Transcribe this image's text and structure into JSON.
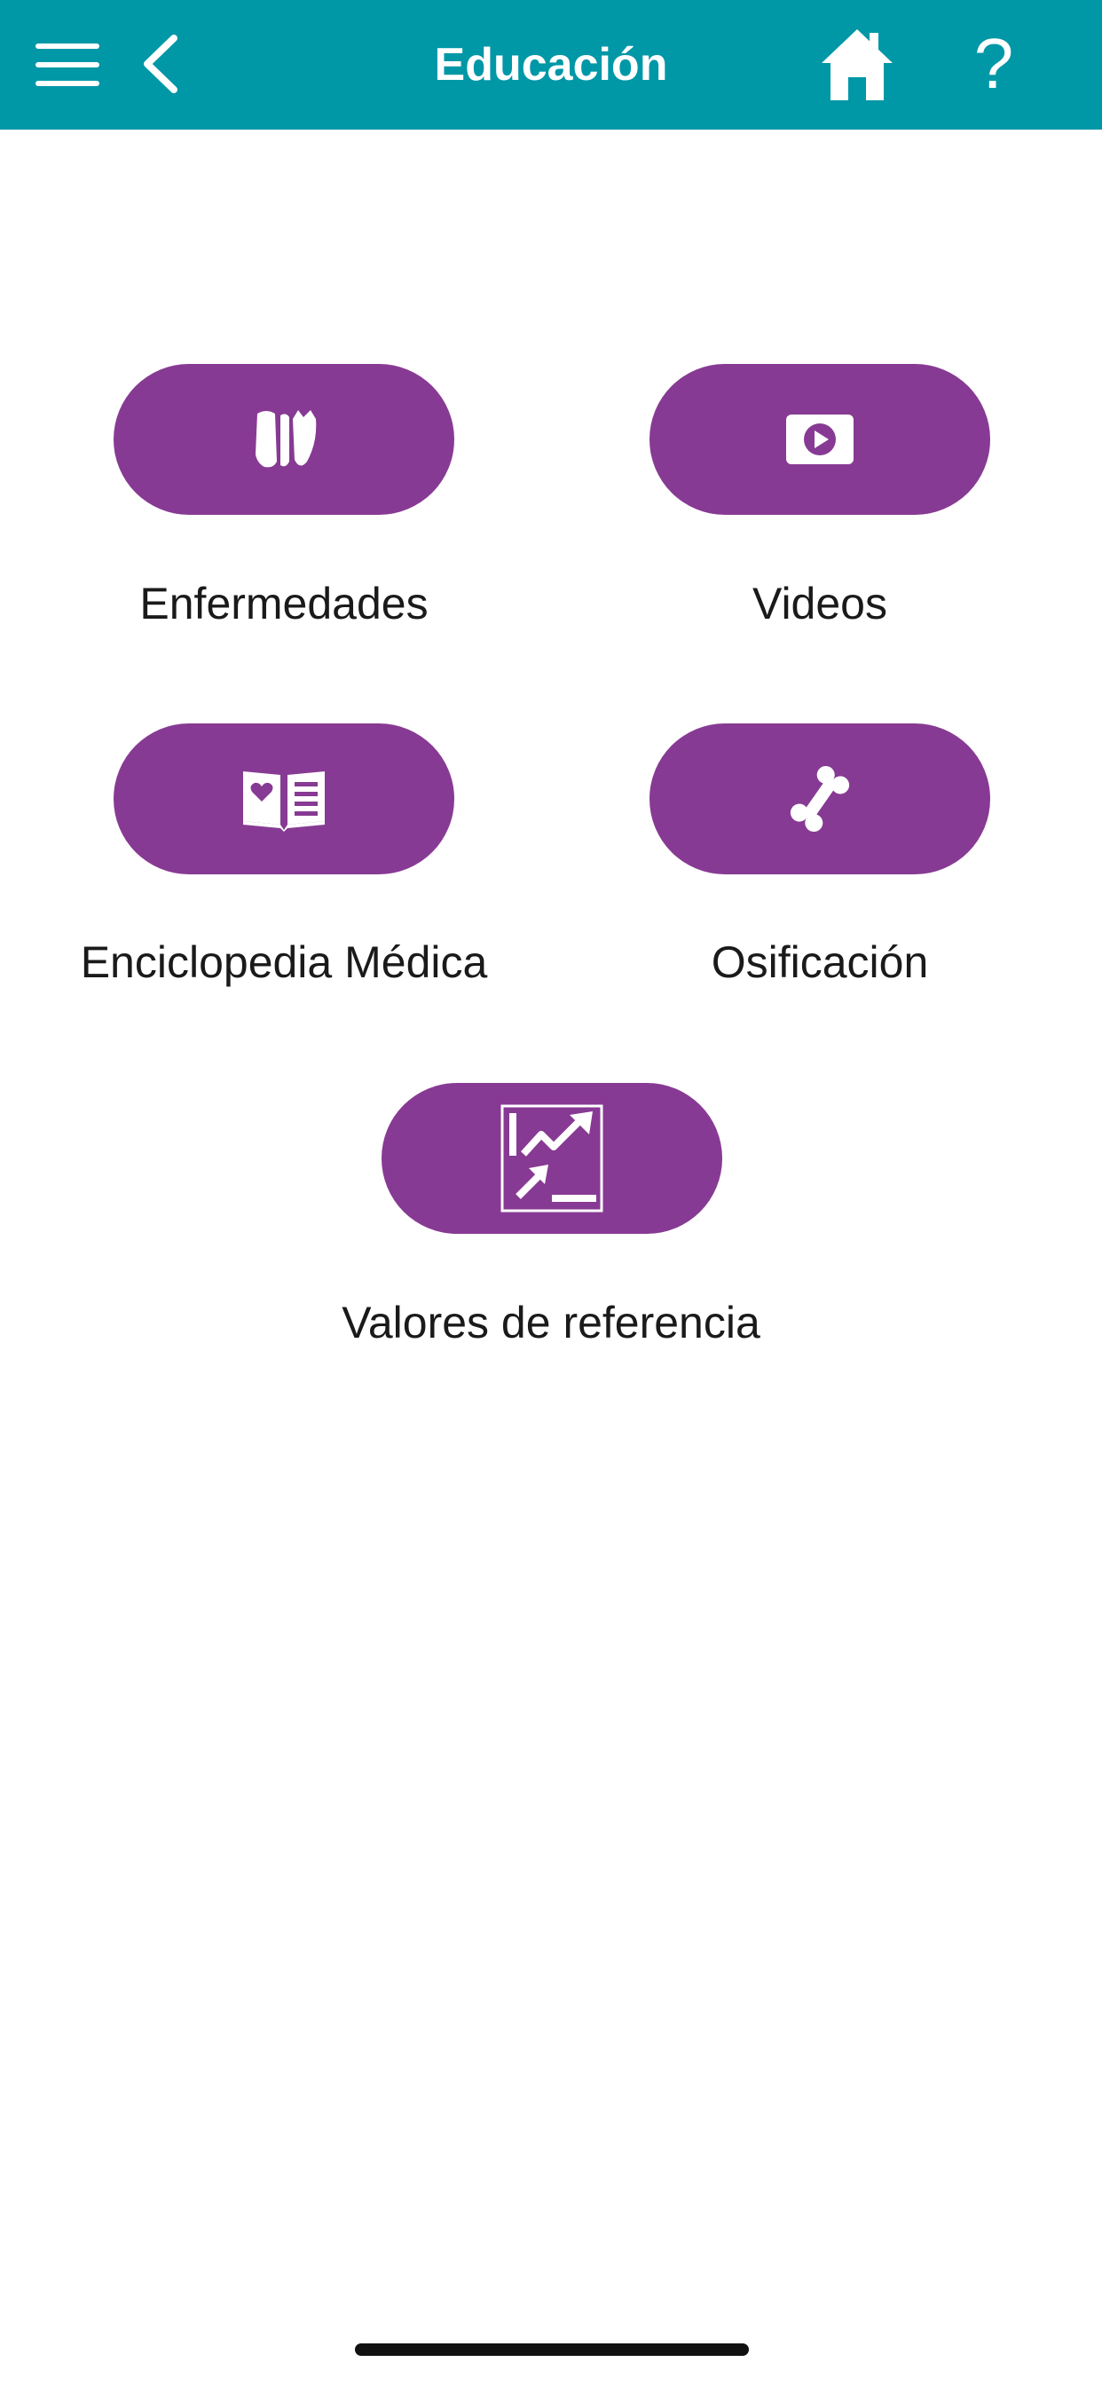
{
  "header": {
    "title": "Educación",
    "help_label": "?"
  },
  "tiles": [
    {
      "label": "Enfermedades",
      "icon": "organs-icon"
    },
    {
      "label": "Videos",
      "icon": "play-video-icon"
    },
    {
      "label": "Enciclopedia Médica",
      "icon": "open-book-heart-icon"
    },
    {
      "label": "Osificación",
      "icon": "bone-icon"
    },
    {
      "label": "Valores de referencia",
      "icon": "trend-chart-icon"
    }
  ],
  "colors": {
    "header_bg": "#0097a7",
    "tile_bg": "#873a93",
    "text": "#1a1a1a"
  }
}
